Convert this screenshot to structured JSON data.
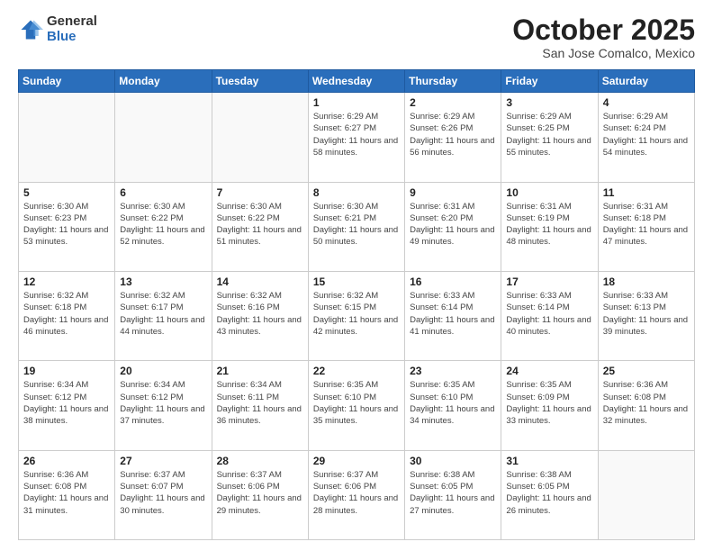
{
  "header": {
    "logo_general": "General",
    "logo_blue": "Blue",
    "month_title": "October 2025",
    "location": "San Jose Comalco, Mexico"
  },
  "weekdays": [
    "Sunday",
    "Monday",
    "Tuesday",
    "Wednesday",
    "Thursday",
    "Friday",
    "Saturday"
  ],
  "weeks": [
    [
      {
        "day": "",
        "sunrise": "",
        "sunset": "",
        "daylight": ""
      },
      {
        "day": "",
        "sunrise": "",
        "sunset": "",
        "daylight": ""
      },
      {
        "day": "",
        "sunrise": "",
        "sunset": "",
        "daylight": ""
      },
      {
        "day": "1",
        "sunrise": "6:29 AM",
        "sunset": "6:27 PM",
        "daylight": "11 hours and 58 minutes."
      },
      {
        "day": "2",
        "sunrise": "6:29 AM",
        "sunset": "6:26 PM",
        "daylight": "11 hours and 56 minutes."
      },
      {
        "day": "3",
        "sunrise": "6:29 AM",
        "sunset": "6:25 PM",
        "daylight": "11 hours and 55 minutes."
      },
      {
        "day": "4",
        "sunrise": "6:29 AM",
        "sunset": "6:24 PM",
        "daylight": "11 hours and 54 minutes."
      }
    ],
    [
      {
        "day": "5",
        "sunrise": "6:30 AM",
        "sunset": "6:23 PM",
        "daylight": "11 hours and 53 minutes."
      },
      {
        "day": "6",
        "sunrise": "6:30 AM",
        "sunset": "6:22 PM",
        "daylight": "11 hours and 52 minutes."
      },
      {
        "day": "7",
        "sunrise": "6:30 AM",
        "sunset": "6:22 PM",
        "daylight": "11 hours and 51 minutes."
      },
      {
        "day": "8",
        "sunrise": "6:30 AM",
        "sunset": "6:21 PM",
        "daylight": "11 hours and 50 minutes."
      },
      {
        "day": "9",
        "sunrise": "6:31 AM",
        "sunset": "6:20 PM",
        "daylight": "11 hours and 49 minutes."
      },
      {
        "day": "10",
        "sunrise": "6:31 AM",
        "sunset": "6:19 PM",
        "daylight": "11 hours and 48 minutes."
      },
      {
        "day": "11",
        "sunrise": "6:31 AM",
        "sunset": "6:18 PM",
        "daylight": "11 hours and 47 minutes."
      }
    ],
    [
      {
        "day": "12",
        "sunrise": "6:32 AM",
        "sunset": "6:18 PM",
        "daylight": "11 hours and 46 minutes."
      },
      {
        "day": "13",
        "sunrise": "6:32 AM",
        "sunset": "6:17 PM",
        "daylight": "11 hours and 44 minutes."
      },
      {
        "day": "14",
        "sunrise": "6:32 AM",
        "sunset": "6:16 PM",
        "daylight": "11 hours and 43 minutes."
      },
      {
        "day": "15",
        "sunrise": "6:32 AM",
        "sunset": "6:15 PM",
        "daylight": "11 hours and 42 minutes."
      },
      {
        "day": "16",
        "sunrise": "6:33 AM",
        "sunset": "6:14 PM",
        "daylight": "11 hours and 41 minutes."
      },
      {
        "day": "17",
        "sunrise": "6:33 AM",
        "sunset": "6:14 PM",
        "daylight": "11 hours and 40 minutes."
      },
      {
        "day": "18",
        "sunrise": "6:33 AM",
        "sunset": "6:13 PM",
        "daylight": "11 hours and 39 minutes."
      }
    ],
    [
      {
        "day": "19",
        "sunrise": "6:34 AM",
        "sunset": "6:12 PM",
        "daylight": "11 hours and 38 minutes."
      },
      {
        "day": "20",
        "sunrise": "6:34 AM",
        "sunset": "6:12 PM",
        "daylight": "11 hours and 37 minutes."
      },
      {
        "day": "21",
        "sunrise": "6:34 AM",
        "sunset": "6:11 PM",
        "daylight": "11 hours and 36 minutes."
      },
      {
        "day": "22",
        "sunrise": "6:35 AM",
        "sunset": "6:10 PM",
        "daylight": "11 hours and 35 minutes."
      },
      {
        "day": "23",
        "sunrise": "6:35 AM",
        "sunset": "6:10 PM",
        "daylight": "11 hours and 34 minutes."
      },
      {
        "day": "24",
        "sunrise": "6:35 AM",
        "sunset": "6:09 PM",
        "daylight": "11 hours and 33 minutes."
      },
      {
        "day": "25",
        "sunrise": "6:36 AM",
        "sunset": "6:08 PM",
        "daylight": "11 hours and 32 minutes."
      }
    ],
    [
      {
        "day": "26",
        "sunrise": "6:36 AM",
        "sunset": "6:08 PM",
        "daylight": "11 hours and 31 minutes."
      },
      {
        "day": "27",
        "sunrise": "6:37 AM",
        "sunset": "6:07 PM",
        "daylight": "11 hours and 30 minutes."
      },
      {
        "day": "28",
        "sunrise": "6:37 AM",
        "sunset": "6:06 PM",
        "daylight": "11 hours and 29 minutes."
      },
      {
        "day": "29",
        "sunrise": "6:37 AM",
        "sunset": "6:06 PM",
        "daylight": "11 hours and 28 minutes."
      },
      {
        "day": "30",
        "sunrise": "6:38 AM",
        "sunset": "6:05 PM",
        "daylight": "11 hours and 27 minutes."
      },
      {
        "day": "31",
        "sunrise": "6:38 AM",
        "sunset": "6:05 PM",
        "daylight": "11 hours and 26 minutes."
      },
      {
        "day": "",
        "sunrise": "",
        "sunset": "",
        "daylight": ""
      }
    ]
  ]
}
